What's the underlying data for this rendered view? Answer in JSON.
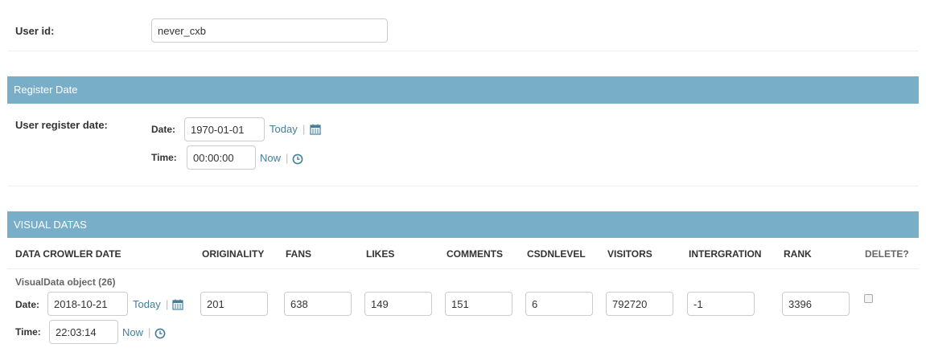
{
  "user": {
    "label": "User id:",
    "value": "never_cxb"
  },
  "register": {
    "section_title": "Register Date",
    "field_label": "User register date:",
    "date_label": "Date:",
    "date_value": "1970-01-01",
    "today_link": "Today",
    "time_label": "Time:",
    "time_value": "00:00:00",
    "now_link": "Now",
    "separator": "|"
  },
  "visual": {
    "section_title": "VISUAL DATAS",
    "columns": {
      "crawler_date": "DATA CROWLER DATE",
      "originality": "ORIGINALITY",
      "fans": "FANS",
      "likes": "LIKES",
      "comments": "COMMENTS",
      "csdnlevel": "CSDNLEVEL",
      "visitors": "VISITORS",
      "intergration": "INTERGRATION",
      "rank": "RANK",
      "delete": "DELETE?"
    },
    "row": {
      "object_label": "VisualData object (26)",
      "date_label": "Date:",
      "date_value": "2018-10-21",
      "today_link": "Today",
      "time_label": "Time:",
      "time_value": "22:03:14",
      "now_link": "Now",
      "separator": "|",
      "originality": "201",
      "fans": "638",
      "likes": "149",
      "comments": "151",
      "csdnlevel": "6",
      "visitors": "792720",
      "intergration": "-1",
      "rank": "3396"
    }
  },
  "colors": {
    "section_header": "#79aec8",
    "link": "#447e9b"
  }
}
